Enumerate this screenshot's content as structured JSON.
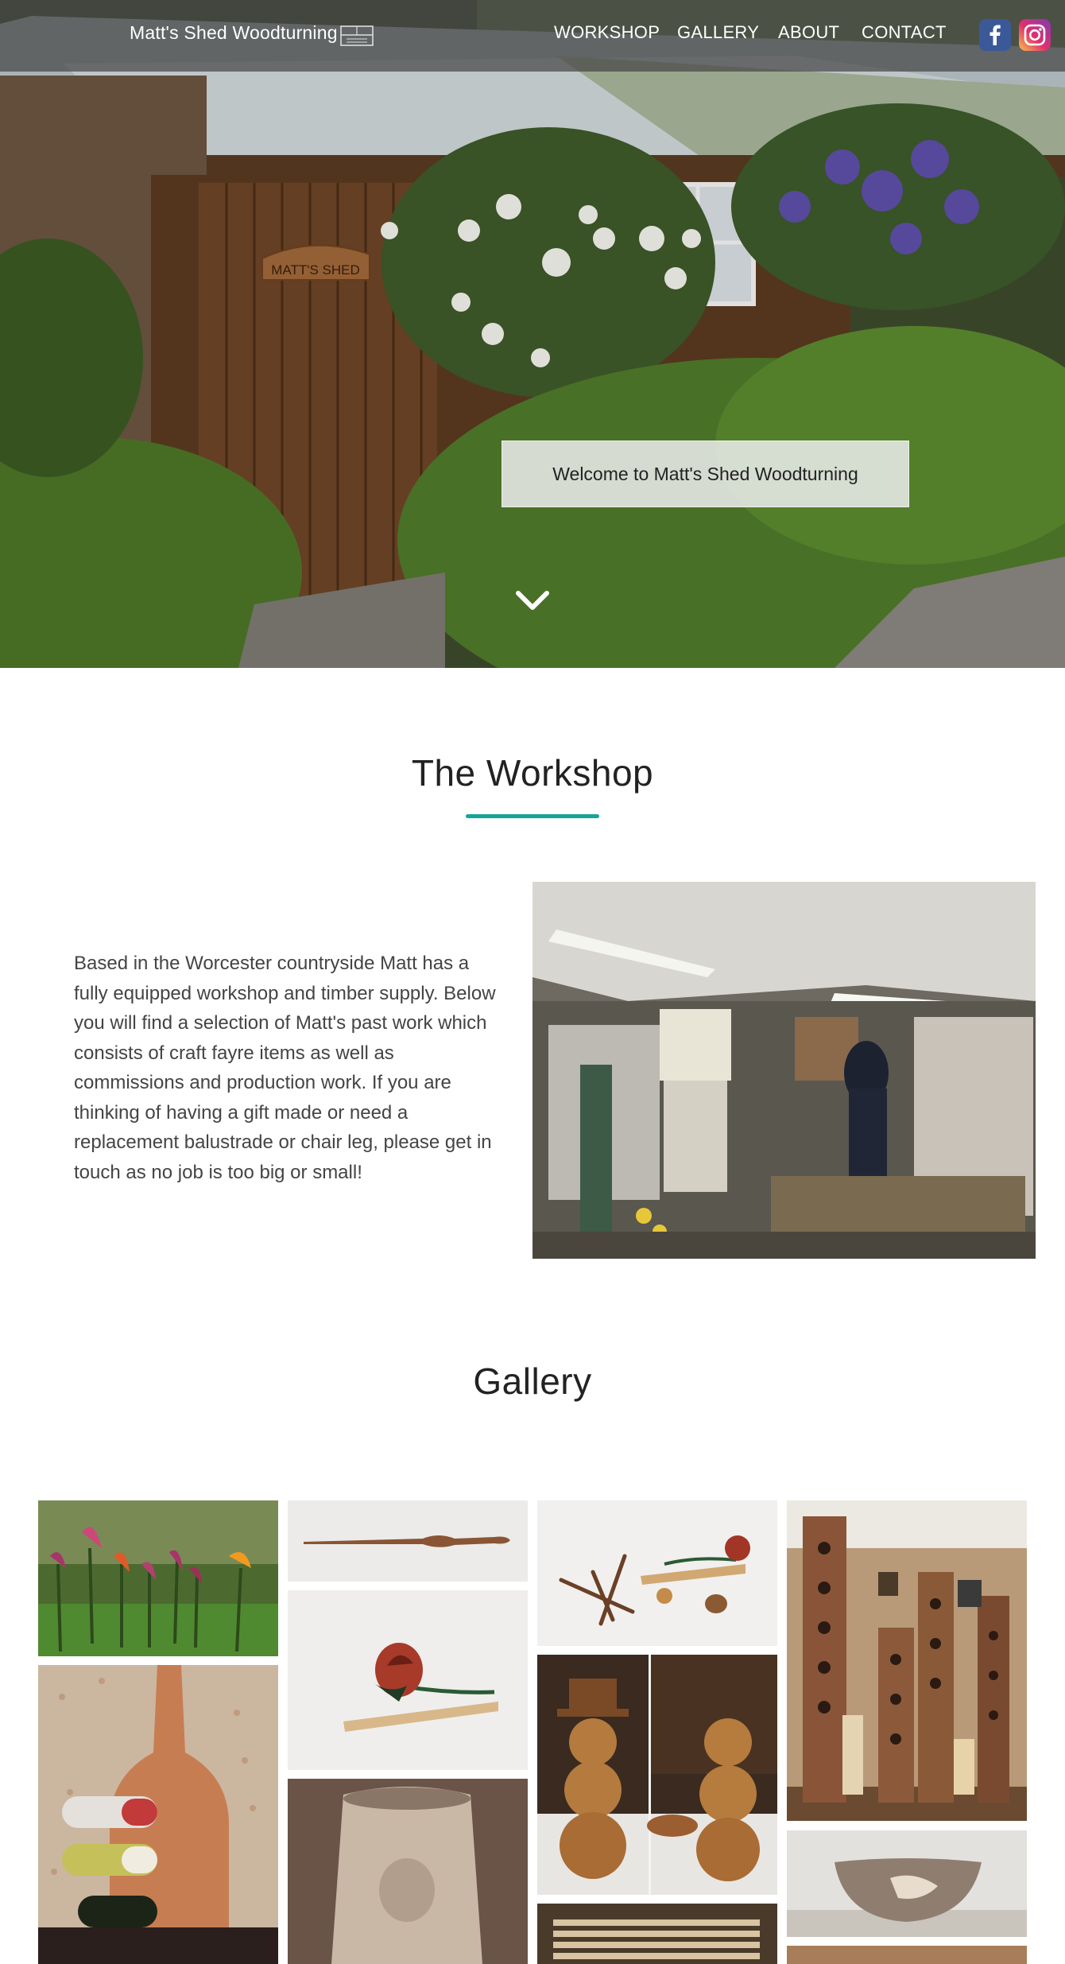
{
  "header": {
    "brand": "Matt's Shed Woodturning",
    "nav": [
      "WORKSHOP",
      "GALLERY",
      "ABOUT",
      "CONTACT"
    ],
    "social": [
      "facebook-icon",
      "instagram-icon"
    ]
  },
  "hero": {
    "welcome": "Welcome to Matt's Shed Woodturning",
    "sign_text": "MATT'S SHED"
  },
  "workshop": {
    "title": "The Workshop",
    "body": "Based in the Worcester countryside Matt has a fully equipped workshop and timber supply. Below you will find a selection of Matt's past work which consists of craft fayre items as well as commissions and production work. If you are thinking of having a gift made or need a replacement balustrade or chair leg, please get in touch as no job is too big or small!"
  },
  "gallery": {
    "title": "Gallery"
  },
  "colors": {
    "accent": "#16a39a",
    "topbar": "rgba(70,70,70,0.72)",
    "facebook": "#3b5998"
  }
}
